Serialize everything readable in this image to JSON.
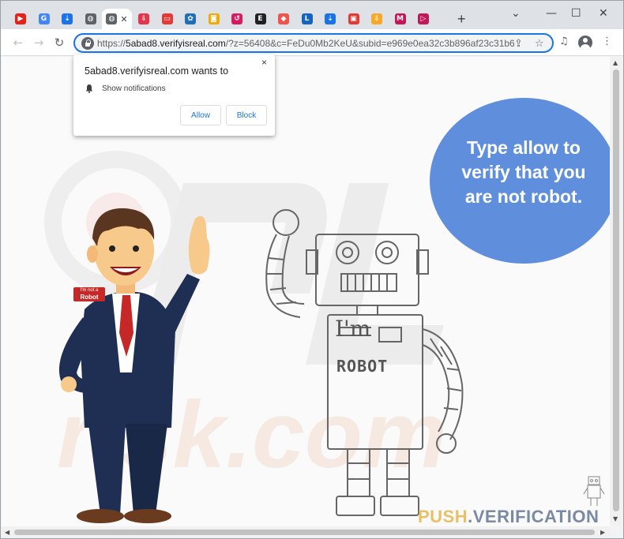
{
  "browser": {
    "tabs": [
      {
        "icon": "youtube-icon",
        "color": "#e62117",
        "glyph": "▶"
      },
      {
        "icon": "google-icon",
        "color": "#4285f4",
        "glyph": "G"
      },
      {
        "icon": "cloud-download-icon",
        "color": "#1a73e8",
        "glyph": "⇣"
      },
      {
        "icon": "globe-icon",
        "color": "#5f6368",
        "glyph": "◍"
      },
      {
        "icon": "globe-icon",
        "color": "#5f6368",
        "glyph": "◍"
      },
      {
        "icon": "download-red-icon",
        "color": "#e8334a",
        "glyph": "⇩"
      },
      {
        "icon": "red-card-icon",
        "color": "#e53935",
        "glyph": "▭"
      },
      {
        "icon": "gear-flower-icon",
        "color": "#1e6fb8",
        "glyph": "✿"
      },
      {
        "icon": "camera-icon",
        "color": "#f2a900",
        "glyph": "◙"
      },
      {
        "icon": "refresh-pink-icon",
        "color": "#d81b60",
        "glyph": "↺"
      },
      {
        "icon": "e-icon",
        "color": "#202124",
        "glyph": "E"
      },
      {
        "icon": "red-tag-icon",
        "color": "#ef5350",
        "glyph": "◆"
      },
      {
        "icon": "l-icon",
        "color": "#1565c0",
        "glyph": "L"
      },
      {
        "icon": "cloud-download-icon",
        "color": "#1a73e8",
        "glyph": "⇣"
      },
      {
        "icon": "video-icon",
        "color": "#e53935",
        "glyph": "▣"
      },
      {
        "icon": "download-yellow-icon",
        "color": "#f9a825",
        "glyph": "⇩"
      },
      {
        "icon": "ym-icon",
        "color": "#c2185b",
        "glyph": "M"
      },
      {
        "icon": "play-pink-icon",
        "color": "#c2185b",
        "glyph": "▷"
      }
    ],
    "active_tab_index": 4,
    "new_tab": "+",
    "window": {
      "minimize": "—",
      "maximize": "☐",
      "close": "✕",
      "chevron": "⌄"
    },
    "nav": {
      "back": "←",
      "forward": "→",
      "reload": "↻"
    },
    "url_host": "5abad8.verifyisreal.com",
    "url_prefix": "https://",
    "url_rest": "/?z=56408&c=FeDu0Mb2KeU&subid=e969e0ea32c3b896af23c31b6",
    "omnibox_icons": {
      "share": "⇪",
      "bookmark": "☆"
    },
    "toolbar_icons": {
      "media": "♫",
      "menu": "⋮"
    }
  },
  "popup": {
    "title": "5abad8.verifyisreal.com wants to",
    "permission": "Show notifications",
    "allow": "Allow",
    "block": "Block",
    "close": "×"
  },
  "page": {
    "bubble_text": "Type allow to verify that you are not robot.",
    "badge_line1": "I'm not a",
    "badge_line2": "Robot",
    "robot_line1": "I'm",
    "robot_line2": "ROBOT",
    "brand_part1": "PUSH",
    "brand_dot": ".",
    "brand_part2": "VERIFICATION"
  },
  "colors": {
    "bubble": "#5f8fdc",
    "accent": "#1a73e8"
  }
}
